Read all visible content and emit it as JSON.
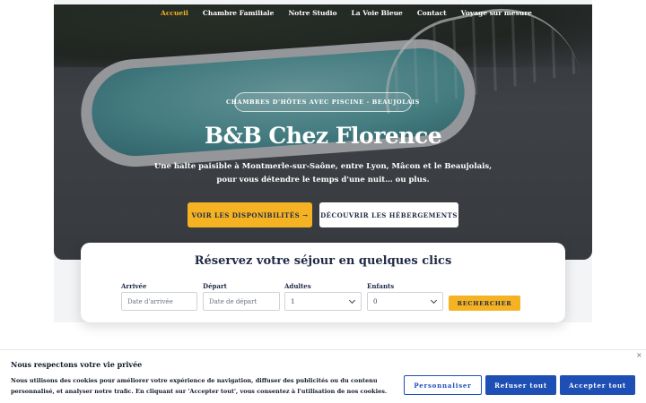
{
  "nav": {
    "items": [
      {
        "label": "Accueil",
        "active": true
      },
      {
        "label": "Chambre Familiale",
        "active": false
      },
      {
        "label": "Notre Studio",
        "active": false
      },
      {
        "label": "La Voie Bleue",
        "active": false
      },
      {
        "label": "Contact",
        "active": false
      },
      {
        "label": "Voyage sur mesure",
        "active": false
      }
    ]
  },
  "hero": {
    "tagline": "CHAMBRES D'HÔTES AVEC PISCINE - BEAUJOLAIS",
    "title": "B&B Chez Florence",
    "subtitle": "Une halte paisible à Montmerle-sur-Saône, entre Lyon, Mâcon et le Beaujolais, pour vous détendre le temps d'une nuit… ou plus.",
    "primary_button": "VOIR LES DISPONIBILITÉS →",
    "secondary_button": "DÉCOUVRIR LES HÉBERGEMENTS"
  },
  "booking": {
    "title": "Réservez votre séjour en quelques clics",
    "arrival": {
      "label": "Arrivée",
      "placeholder": "Date d'arrivée"
    },
    "departure": {
      "label": "Départ",
      "placeholder": "Date de départ"
    },
    "adults": {
      "label": "Adultes",
      "value": "1"
    },
    "children": {
      "label": "Enfants",
      "value": "0"
    },
    "search_button": "RECHERCHER"
  },
  "cookie": {
    "title": "Nous respectons votre vie privée",
    "text": "Nous utilisons des cookies pour améliorer votre expérience de navigation, diffuser des publicités ou du contenu personnalisé, et analyser notre trafic. En cliquant sur 'Accepter tout', vous consentez à l'utilisation de nos cookies.",
    "close_icon": "×",
    "customize_button": "Personnaliser",
    "refuse_button": "Refuser tout",
    "accept_button": "Accepter tout"
  },
  "colors": {
    "accent": "#f5b324",
    "navy": "#1f2a44",
    "cookie_blue": "#1e4fb5"
  }
}
